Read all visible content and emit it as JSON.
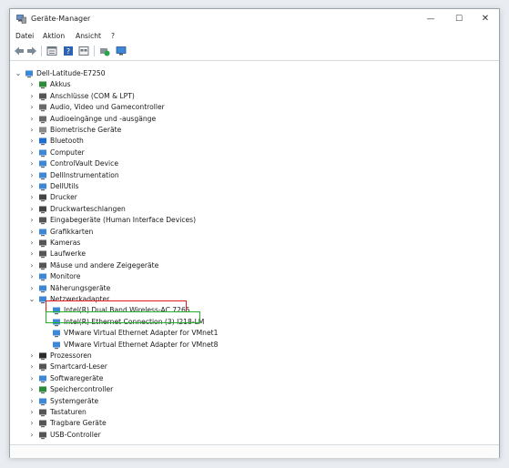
{
  "window": {
    "title": "Geräte-Manager",
    "controls": {
      "minimize": "—",
      "maximize": "☐",
      "close": "✕"
    }
  },
  "menu": [
    "Datei",
    "Aktion",
    "Ansicht",
    "?"
  ],
  "toolbar": [
    "back-icon",
    "forward-icon",
    "properties-icon",
    "help-icon",
    "view-icon",
    "update-icon",
    "monitor-icon"
  ],
  "tree": {
    "root": "Dell-Latitude-E7250",
    "categories": [
      "Akkus",
      "Anschlüsse (COM & LPT)",
      "Audio, Video und Gamecontroller",
      "Audioeingänge und -ausgänge",
      "Biometrische Geräte",
      "Bluetooth",
      "Computer",
      "ControlVault Device",
      "DellInstrumentation",
      "DellUtils",
      "Drucker",
      "Druckwarteschlangen",
      "Eingabegeräte (Human Interface Devices)",
      "Grafikkarten",
      "Kameras",
      "Laufwerke",
      "Mäuse und andere Zeigegeräte",
      "Monitore",
      "Näherungsgeräte",
      "Netzwerkadapter"
    ],
    "network_children": [
      "Intel(R) Dual Band Wireless-AC 7265",
      "Intel(R) Ethernet Connection (3) I218-LM",
      "VMware Virtual Ethernet Adapter for VMnet1",
      "VMware Virtual Ethernet Adapter for VMnet8"
    ],
    "categories_after": [
      "Prozessoren",
      "Smartcard-Leser",
      "Softwaregeräte",
      "Speichercontroller",
      "Systemgeräte",
      "Tastaturen",
      "Tragbare Geräte",
      "USB-Controller"
    ]
  },
  "colors": {
    "highlight_red": "#e01c1c",
    "highlight_green": "#21b32a"
  }
}
